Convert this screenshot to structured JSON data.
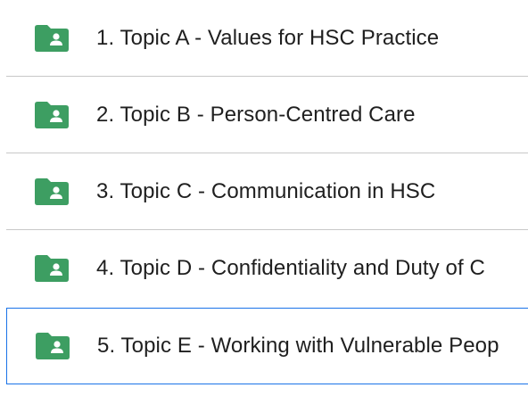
{
  "folder_list": {
    "items": [
      {
        "label": "1. Topic A - Values for HSC Practice",
        "icon": "shared-folder-icon",
        "selected": false
      },
      {
        "label": "2. Topic B - Person-Centred Care",
        "icon": "shared-folder-icon",
        "selected": false
      },
      {
        "label": "3. Topic C - Communication in HSC",
        "icon": "shared-folder-icon",
        "selected": false
      },
      {
        "label": "4. Topic D - Confidentiality and Duty of C",
        "icon": "shared-folder-icon",
        "selected": false
      },
      {
        "label": "5. Topic E - Working with Vulnerable Peop",
        "icon": "shared-folder-icon",
        "selected": true
      }
    ]
  },
  "colors": {
    "folder_green": "#3d9e62",
    "selection_border": "#1a73e8",
    "divider": "#c8c8c8",
    "text": "#1f1f1f"
  }
}
